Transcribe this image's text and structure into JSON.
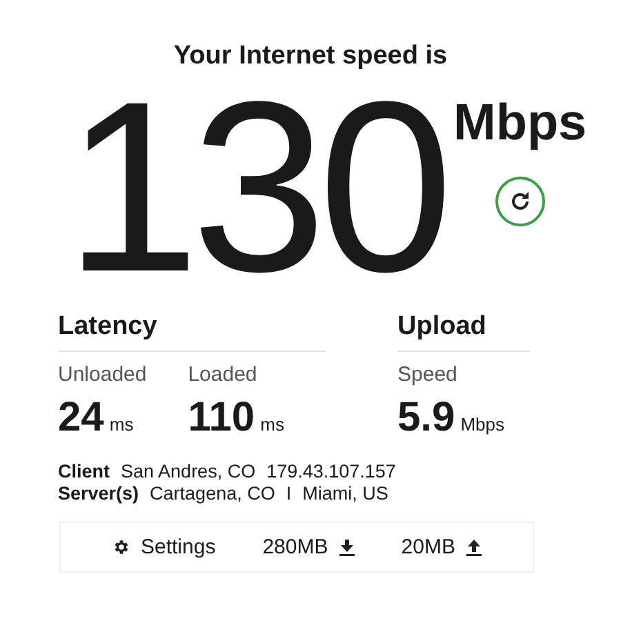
{
  "heading": "Your Internet speed is",
  "speed": {
    "value": "130",
    "unit": "Mbps"
  },
  "latency": {
    "title": "Latency",
    "metrics": [
      {
        "label": "Unloaded",
        "value": "24",
        "unit": "ms"
      },
      {
        "label": "Loaded",
        "value": "110",
        "unit": "ms"
      }
    ]
  },
  "upload": {
    "title": "Upload",
    "metrics": [
      {
        "label": "Speed",
        "value": "5.9",
        "unit": "Mbps"
      }
    ]
  },
  "info": [
    {
      "label": "Client",
      "parts": [
        "San Andres, CO",
        "179.43.107.157"
      ]
    },
    {
      "label": "Server(s)",
      "parts": [
        "Cartagena, CO",
        "I",
        "Miami, US"
      ]
    }
  ],
  "footer": {
    "settings": "Settings",
    "download": "280MB",
    "upload": "20MB"
  }
}
